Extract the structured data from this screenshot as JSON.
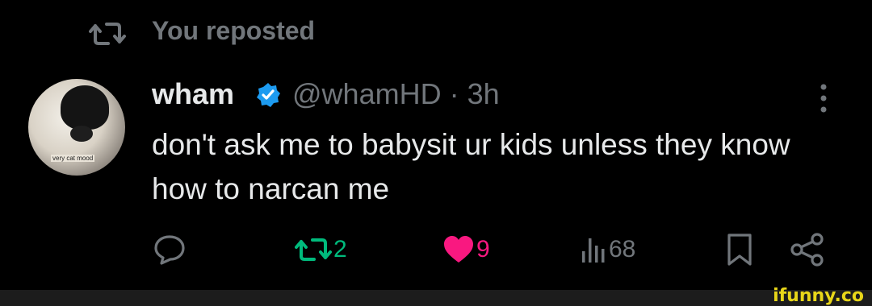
{
  "social_context": {
    "text": "You reposted",
    "icon": "repost-icon"
  },
  "post": {
    "author_name": "wham",
    "verified": true,
    "handle_time": "@whamHD · 3h",
    "text": "don't ask me to babysit ur kids unless they know how to narcan me",
    "avatar_caption": "very cat mood"
  },
  "actions": {
    "reply": {
      "icon": "reply-icon"
    },
    "repost": {
      "icon": "repost-icon",
      "count": "2",
      "active": true,
      "color": "#00ba7c"
    },
    "like": {
      "icon": "heart-icon",
      "count": "9",
      "active": true,
      "color": "#f91880"
    },
    "views": {
      "icon": "views-icon",
      "count": "68"
    },
    "bookmark": {
      "icon": "bookmark-icon"
    },
    "share": {
      "icon": "share-icon"
    }
  },
  "watermark": {
    "text": "ifunny.co",
    "color": "#e8d619"
  },
  "colors": {
    "background": "#000000",
    "text": "#e7e9ea",
    "muted": "#71767b",
    "verified": "#1d9bf0"
  }
}
